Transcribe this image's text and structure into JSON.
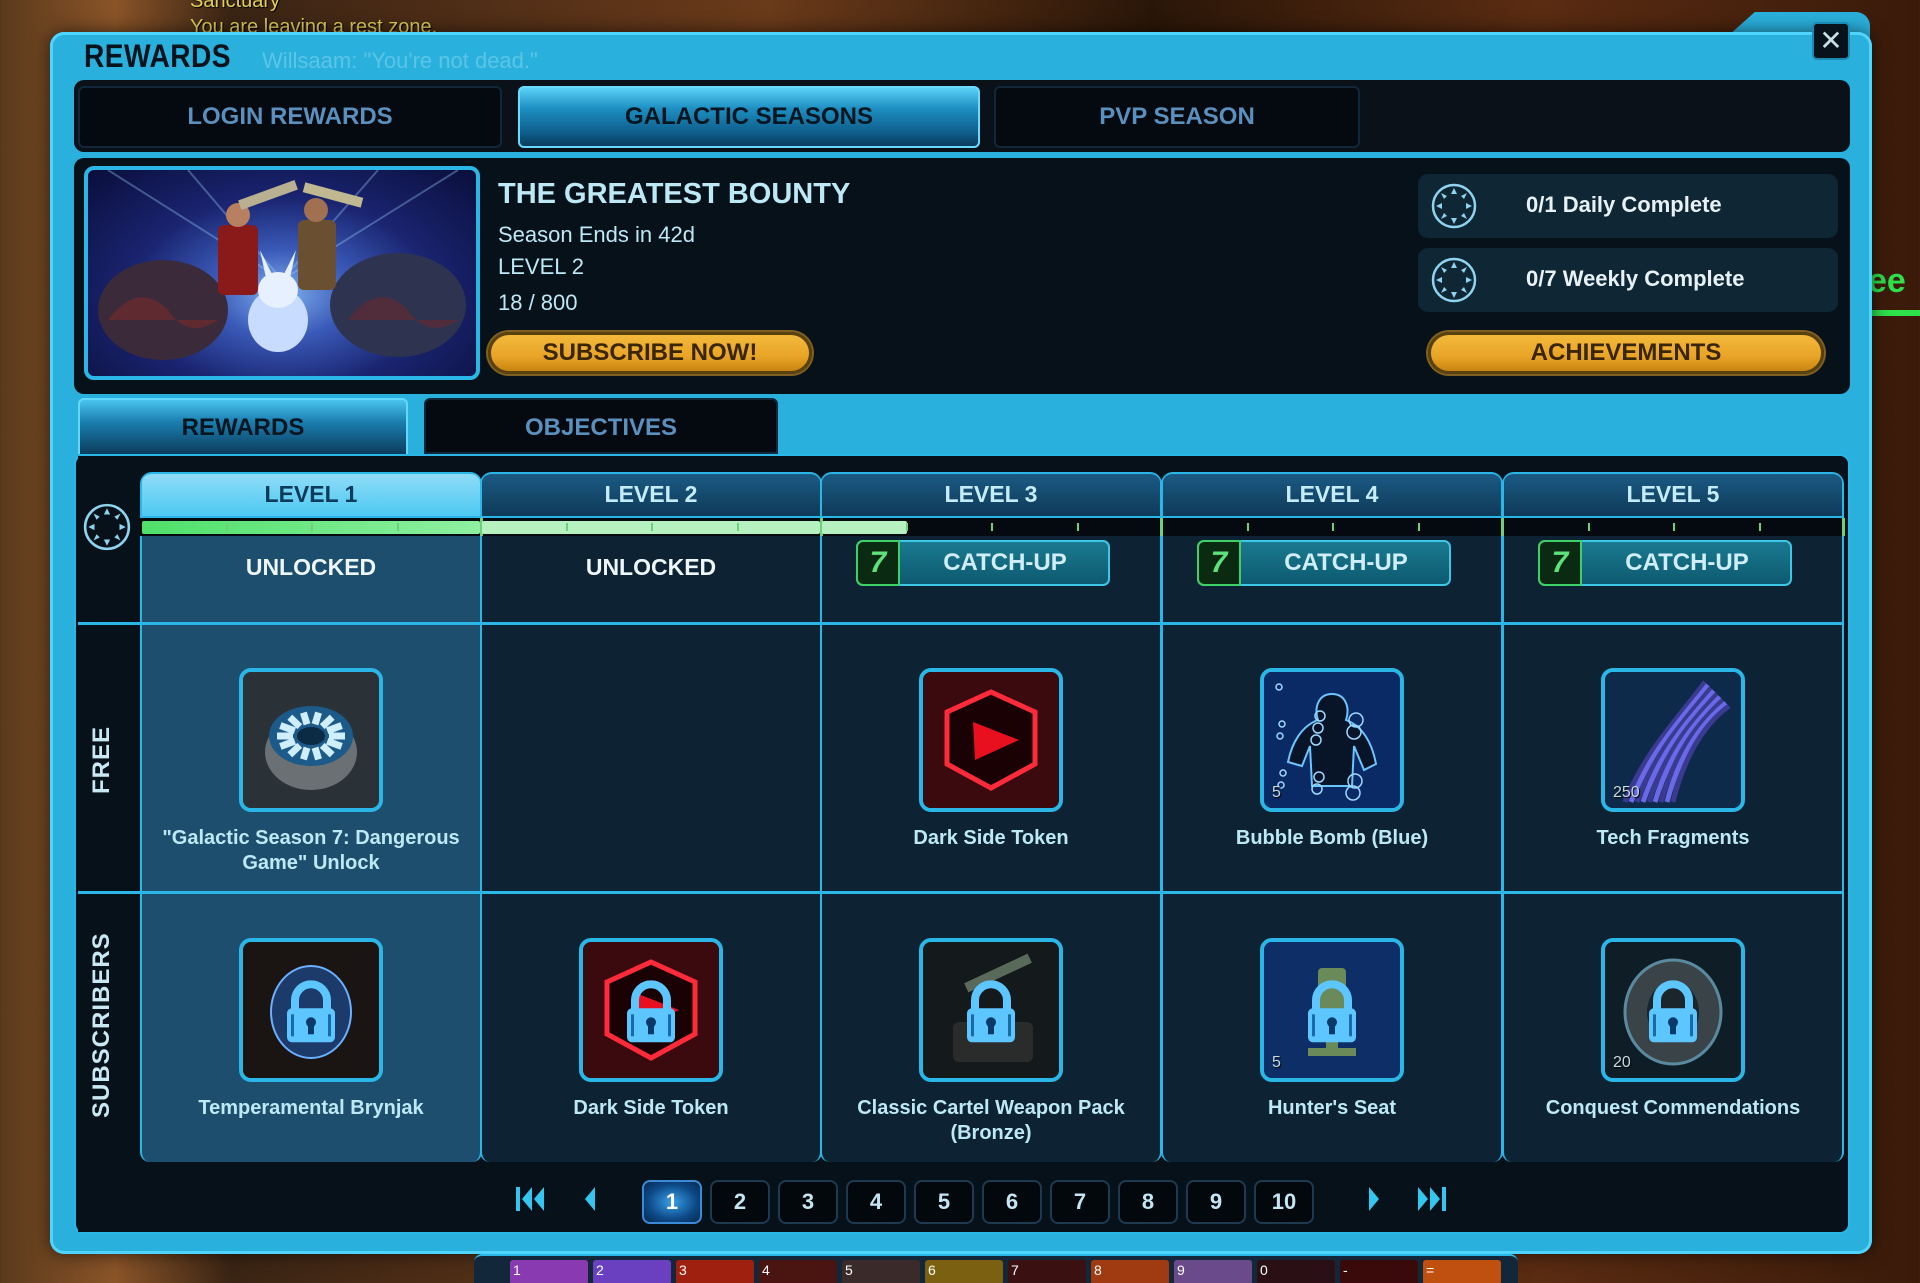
{
  "background": {
    "chat_lines": [
      "Sanctuary",
      "You are leaving a rest zone."
    ],
    "ghost_chat": "Willsaam: \"You're not dead.\"",
    "nameplate_fragment": "ee"
  },
  "window": {
    "title": "REWARDS",
    "close_icon": "close-icon"
  },
  "top_tabs": [
    {
      "label": "LOGIN REWARDS",
      "active": false
    },
    {
      "label": "GALACTIC SEASONS",
      "active": true
    },
    {
      "label": "PVP SEASON",
      "active": false
    }
  ],
  "season": {
    "name": "THE GREATEST BOUNTY",
    "ends": "Season Ends in 42d",
    "level": "LEVEL 2",
    "progress_text": "18 / 800",
    "progress_fraction": 0.0225,
    "subscribe_label": "SUBSCRIBE NOW!",
    "achievements_label": "ACHIEVEMENTS",
    "objectives": [
      {
        "icon": "season-sun-moon-icon",
        "text": "0/1 Daily Complete"
      },
      {
        "icon": "season-sun-moon-icon",
        "text": "0/7 Weekly Complete"
      }
    ]
  },
  "sub_tabs": [
    {
      "label": "REWARDS",
      "active": true
    },
    {
      "label": "OBJECTIVES",
      "active": false
    }
  ],
  "row_labels": {
    "free": "FREE",
    "subscribers": "SUBSCRIBERS"
  },
  "track": {
    "segment_fill": [
      1.0,
      1.0,
      0.25,
      0,
      0
    ],
    "colors": {
      "filled": "#4fe06a",
      "partial": "#b6f2c0",
      "tick": "#6fcf7f"
    }
  },
  "levels": [
    {
      "label": "LEVEL 1",
      "current": true,
      "status": "UNLOCKED",
      "catchup": null,
      "free": {
        "name": "\"Galactic Season 7: Dangerous Game\" Unlock",
        "icon": "season-unlock-icon",
        "qty": null
      },
      "subscriber": {
        "name": "Temperamental Brynjak",
        "icon": "brynjak-mount-icon",
        "qty": null,
        "locked": true
      }
    },
    {
      "label": "LEVEL 2",
      "current": false,
      "status": "UNLOCKED",
      "catchup": null,
      "free": null,
      "subscriber": {
        "name": "Dark Side Token",
        "icon": "dark-side-token-icon",
        "qty": null,
        "locked": true
      }
    },
    {
      "label": "LEVEL 3",
      "current": false,
      "status": null,
      "catchup": {
        "label": "CATCH-UP",
        "badge": "7"
      },
      "free": {
        "name": "Dark Side Token",
        "icon": "dark-side-token-icon",
        "qty": null
      },
      "subscriber": {
        "name": "Classic Cartel Weapon Pack (Bronze)",
        "icon": "weapon-pack-icon",
        "qty": null,
        "locked": true
      }
    },
    {
      "label": "LEVEL 4",
      "current": false,
      "status": null,
      "catchup": {
        "label": "CATCH-UP",
        "badge": "7"
      },
      "free": {
        "name": "Bubble Bomb (Blue)",
        "icon": "bubble-bomb-icon",
        "qty": "5"
      },
      "subscriber": {
        "name": "Hunter's Seat",
        "icon": "hunters-seat-icon",
        "qty": "5",
        "locked": true
      }
    },
    {
      "label": "LEVEL 5",
      "current": false,
      "status": null,
      "catchup": {
        "label": "CATCH-UP",
        "badge": "7"
      },
      "free": {
        "name": "Tech Fragments",
        "icon": "tech-fragments-icon",
        "qty": "250"
      },
      "subscriber": {
        "name": "Conquest Commendations",
        "icon": "conquest-commendations-icon",
        "qty": "20",
        "locked": true
      }
    }
  ],
  "pagination": {
    "pages": [
      "1",
      "2",
      "3",
      "4",
      "5",
      "6",
      "7",
      "8",
      "9",
      "10"
    ],
    "current": "1",
    "first_icon": "first-page-icon",
    "prev_icon": "prev-page-icon",
    "next_icon": "next-page-icon",
    "last_icon": "last-page-icon"
  },
  "actionbar": {
    "slots": [
      "1",
      "2",
      "3",
      "4",
      "5",
      "6",
      "7",
      "8",
      "9",
      "0",
      "-",
      "="
    ]
  }
}
